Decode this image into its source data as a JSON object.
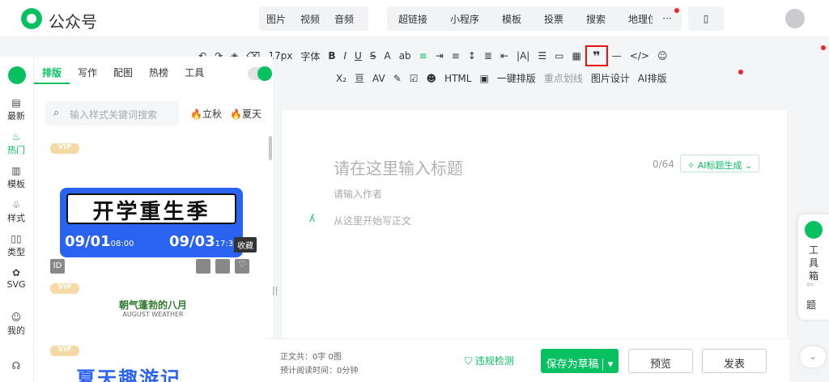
{
  "app": {
    "title": "公众号"
  },
  "insert_menu": {
    "group1": [
      "图片",
      "视频",
      "音频"
    ],
    "group2": [
      "超链接",
      "小程序",
      "模板",
      "投票",
      "搜索",
      "地理位置"
    ],
    "more": "···"
  },
  "toolbar": {
    "font_size": "17px",
    "font_family": "字体",
    "onekey_layout": "一键排版",
    "highlight": "重点划线",
    "image_design": "图片设计",
    "ai_layout": "AI排版"
  },
  "left_rail": {
    "items": [
      "最新",
      "热门",
      "模板",
      "样式",
      "类型",
      "SVG",
      "我的"
    ],
    "active": "热门"
  },
  "panel": {
    "tabs": [
      "排版",
      "写作",
      "配图",
      "热榜",
      "工具"
    ],
    "search_placeholder": "输入样式关键词搜索",
    "hot_tags": [
      "立秋",
      "夏天"
    ],
    "cards": [
      {
        "badge": "VIP",
        "title": "开学重生季",
        "date1": "09/01",
        "time1": "08:00",
        "date2": "09/03",
        "time2": "17:3",
        "tooltip": "收藏",
        "id_label": "ID"
      },
      {
        "badge": "VIP",
        "title": "朝气蓬勃的八月",
        "subtitle": "AUGUST WEATHER"
      },
      {
        "badge": "VIP",
        "title": "夏天趣游记"
      }
    ]
  },
  "editor": {
    "title_placeholder": "请在这里输入标题",
    "counter": "0/64",
    "ai_title": "AI标题生成",
    "author_placeholder": "请输入作者",
    "body_placeholder": "从这里开始写正文"
  },
  "footer": {
    "word_count_label": "正文共：",
    "word_count": "0字 0图",
    "read_time_label": "预计阅读时间：",
    "read_time": "0分钟",
    "compliance": "违规检测",
    "save_draft": "保存为草稿",
    "preview": "预览",
    "publish": "发表"
  },
  "toolbox": {
    "label": "工具箱",
    "tail": "题"
  },
  "colors": {
    "brand": "#07c160",
    "highlight_border": "#e11111",
    "vip": "#f6d9a5",
    "ticket_blue": "#2b63f1"
  }
}
